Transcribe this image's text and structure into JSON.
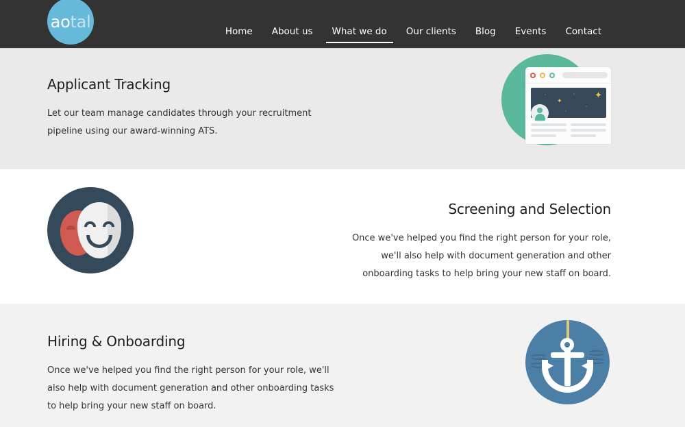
{
  "header": {
    "logo": {
      "name": "aotal-logo",
      "text_strong": "ao",
      "text_dim": "tal"
    },
    "nav": [
      {
        "label": "Home",
        "active": false
      },
      {
        "label": "About us",
        "active": false
      },
      {
        "label": "What we do",
        "active": true
      },
      {
        "label": "Our clients",
        "active": false
      },
      {
        "label": "Blog",
        "active": false
      },
      {
        "label": "Events",
        "active": false
      },
      {
        "label": "Contact",
        "active": false
      }
    ],
    "bg_color": "#333333",
    "logo_color": "#66b9d9"
  },
  "sections": [
    {
      "id": "applicant-tracking",
      "title": "Applicant Tracking",
      "body": "Let our team manage candidates through your recruitment pipeline using our award-winning ATS.",
      "align": "left",
      "bg_color": "#eaeaea",
      "illustration": "browser-window-icon",
      "illustration_colors": {
        "circle": "#5bb89a",
        "banner": "#38495a",
        "star": "#f2c14a"
      }
    },
    {
      "id": "screening-and-selection",
      "title": "Screening and Selection",
      "body": "Once we've helped you find the right person for your role, we'll also help with document generation and other onboarding tasks to help bring your new staff on board.",
      "align": "right",
      "bg_color": "#ffffff",
      "illustration": "theater-masks-icon",
      "illustration_colors": {
        "circle": "#34495a",
        "sad_mask": "#cf5b50",
        "happy_mask": "#f0f0f0"
      }
    },
    {
      "id": "hiring-and-onboarding",
      "title": "Hiring & Onboarding",
      "body": "Once we've helped you find the right person for your role, we'll also help with document generation and other onboarding tasks to help bring your new staff on board.",
      "align": "left",
      "bg_color": "#f2f2f2",
      "illustration": "anchor-icon",
      "illustration_colors": {
        "circle": "#4c7fa6",
        "anchor": "#ffffff",
        "rope": "#e0c77a"
      }
    }
  ]
}
